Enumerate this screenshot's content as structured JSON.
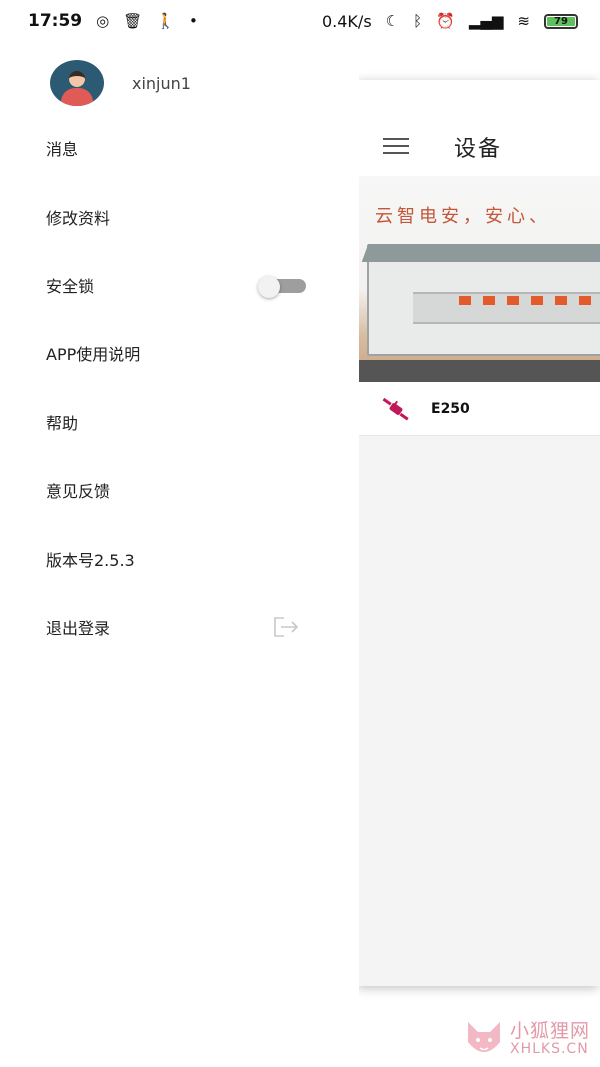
{
  "status_bar": {
    "time": "17:59",
    "left_icons": [
      "weibo-icon",
      "trash-icon",
      "walking-icon",
      "dot-icon"
    ],
    "network_speed": "0.4K/s",
    "right_icons": [
      "moon-icon",
      "bluetooth-icon",
      "alarm-icon",
      "hd-signal-icon",
      "signal-icon",
      "wifi-icon"
    ],
    "battery_level": "79",
    "battery_color": "#5ec15e"
  },
  "drawer": {
    "username": "xinjun1",
    "items": [
      {
        "label": "消息"
      },
      {
        "label": "修改资料"
      },
      {
        "label": "安全锁",
        "control": "toggle",
        "toggle_on": false
      },
      {
        "label": "APP使用说明"
      },
      {
        "label": "帮助"
      },
      {
        "label": "意见反馈"
      },
      {
        "label": "版本号2.5.3"
      },
      {
        "label": "退出登录",
        "control": "logout-icon"
      }
    ]
  },
  "page": {
    "title": "设备",
    "banner_slogan": "云智电安，安心、",
    "devices": [
      {
        "name": "E250",
        "icon": "plug-icon",
        "icon_color": "#c2185b"
      }
    ]
  },
  "watermark": {
    "text_cn": "小狐狸网",
    "text_en": "XHLKS.CN",
    "color": "#e39aa8"
  }
}
